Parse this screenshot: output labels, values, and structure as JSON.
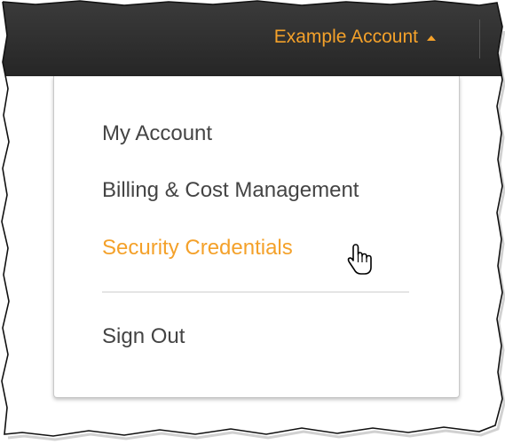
{
  "header": {
    "account_label": "Example Account",
    "caret_icon": "caret-up-icon"
  },
  "menu": {
    "items": [
      {
        "label": "My Account"
      },
      {
        "label": "Billing & Cost Management"
      },
      {
        "label": "Security Credentials",
        "state": "hover"
      },
      {
        "label": "Sign Out"
      }
    ]
  },
  "colors": {
    "topbar": "#2f2f2f",
    "accent": "#f4a12a",
    "menu_text": "#444444",
    "separator": "#cfcfcf"
  },
  "cursor": {
    "icon": "hand-pointer-icon"
  }
}
